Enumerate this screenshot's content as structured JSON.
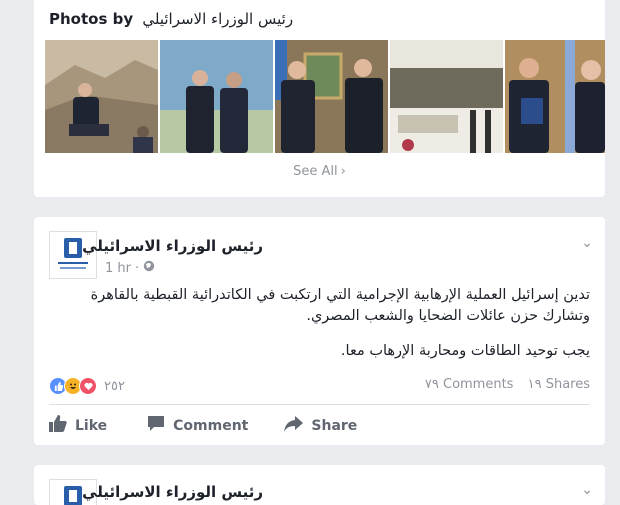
{
  "photos": {
    "title_prefix": "Photos by",
    "title_name": "رئيس الوزراء الاسرائيلي",
    "see_all": "See All"
  },
  "post": {
    "author": "رئيس الوزراء الاسرائيلي",
    "time": "1 hr",
    "time_separator": "·",
    "paragraph1": "تدين إسرائيل العملية الإرهابية الإجرامية التي ارتكبت في الكاتدرائية القبطية بالقاهرة وتشارك حزن عائلات الضحايا والشعب المصري.",
    "paragraph2": "يجب توحيد الطاقات ومحاربة الإرهاب معا.",
    "reaction_count": "٢٥٢",
    "comments": "٧٩ Comments",
    "shares": "١٩ Shares",
    "actions": {
      "like": "Like",
      "comment": "Comment",
      "share": "Share"
    }
  },
  "next_post": {
    "author": "رئيس الوزراء الاسرائيلي"
  },
  "colors": {
    "like_blue": "#5890ff",
    "haha_yellow": "#f7b125",
    "love_red": "#f25268"
  }
}
